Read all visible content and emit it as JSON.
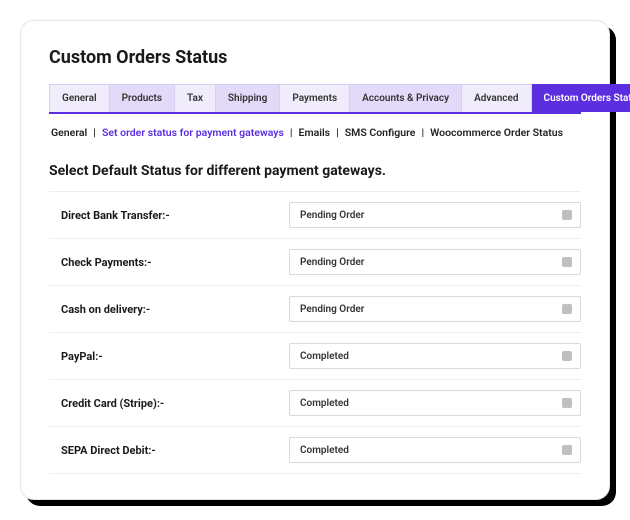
{
  "page_title": "Custom Orders Status",
  "tabs": [
    {
      "label": "General"
    },
    {
      "label": "Products"
    },
    {
      "label": "Tax"
    },
    {
      "label": "Shipping"
    },
    {
      "label": "Payments"
    },
    {
      "label": "Accounts & Privacy"
    },
    {
      "label": "Advanced"
    },
    {
      "label": "Custom Orders Status",
      "active": true
    }
  ],
  "subnav": [
    {
      "label": "General"
    },
    {
      "label": "Set order status for payment gateways",
      "active": true
    },
    {
      "label": "Emails"
    },
    {
      "label": "SMS  Configure"
    },
    {
      "label": "Woocommerce Order Status"
    }
  ],
  "section_title": "Select Default Status for different payment gateways.",
  "rows": [
    {
      "label": "Direct Bank Transfer:-",
      "value": "Pending Order"
    },
    {
      "label": "Check Payments:-",
      "value": "Pending Order"
    },
    {
      "label": "Cash on delivery:-",
      "value": "Pending Order"
    },
    {
      "label": "PayPal:-",
      "value": "Completed"
    },
    {
      "label": "Credit Card  (Stripe):-",
      "value": "Completed"
    },
    {
      "label": "SEPA Direct Debit:-",
      "value": "Completed"
    }
  ]
}
